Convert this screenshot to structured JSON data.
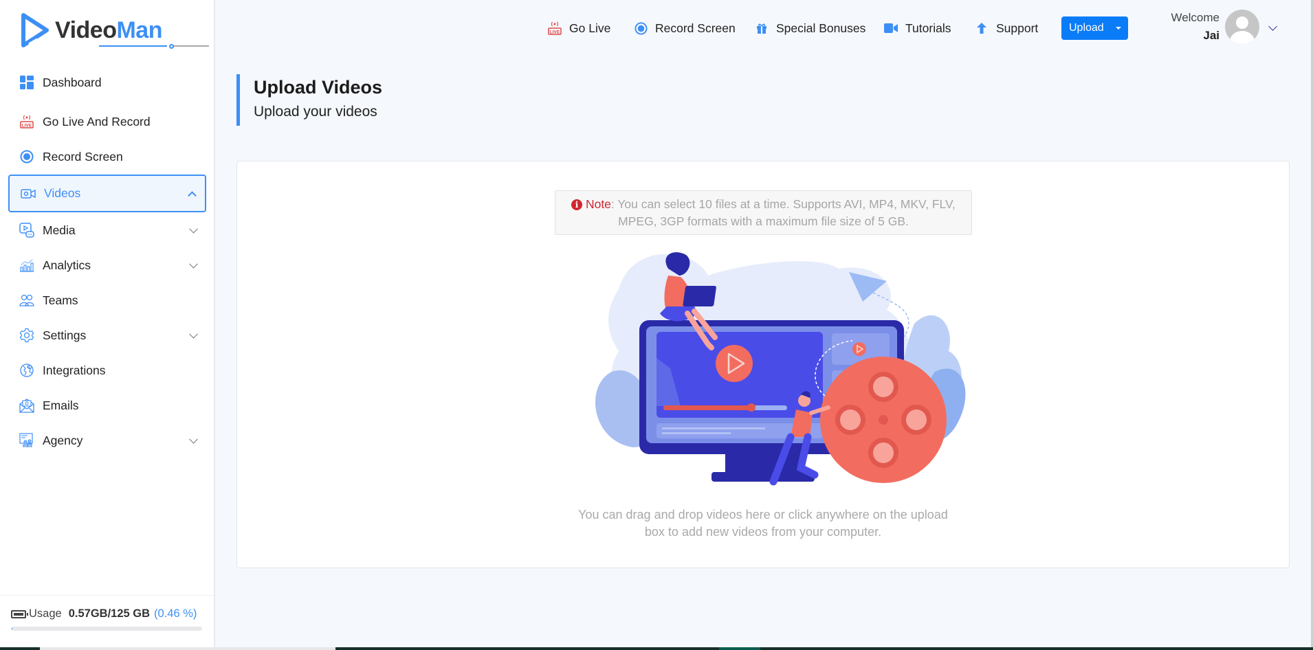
{
  "app": {
    "brand_part1": "Video",
    "brand_part2": "Man"
  },
  "sidebar": {
    "items": [
      {
        "label": "Dashboard",
        "icon": "dashboard-icon",
        "expandable": false
      },
      {
        "label": "Go Live And Record",
        "icon": "live-icon",
        "expandable": false
      },
      {
        "label": "Record Screen",
        "icon": "record-icon",
        "expandable": false
      },
      {
        "label": "Videos",
        "icon": "video-camera-icon",
        "expandable": true,
        "active": true
      },
      {
        "label": "Media",
        "icon": "media-icon",
        "expandable": true
      },
      {
        "label": "Analytics",
        "icon": "analytics-icon",
        "expandable": true
      },
      {
        "label": "Teams",
        "icon": "teams-icon",
        "expandable": false
      },
      {
        "label": "Settings",
        "icon": "gear-icon",
        "expandable": true
      },
      {
        "label": "Integrations",
        "icon": "integrations-icon",
        "expandable": false
      },
      {
        "label": "Emails",
        "icon": "email-icon",
        "expandable": false
      },
      {
        "label": "Agency",
        "icon": "agency-icon",
        "expandable": true
      }
    ],
    "usage": {
      "label": "Usage",
      "value": "0.57GB/125 GB",
      "percent_text": "(0.46 %)",
      "percent": 0.46
    }
  },
  "topnav": {
    "items": [
      {
        "label": "Go Live",
        "icon": "live-icon"
      },
      {
        "label": "Record Screen",
        "icon": "record-icon"
      },
      {
        "label": "Special Bonuses",
        "icon": "gift-icon"
      },
      {
        "label": "Tutorials",
        "icon": "video-camera-icon"
      },
      {
        "label": "Support",
        "icon": "arrow-up-icon"
      }
    ],
    "upload_label": "Upload",
    "welcome_label": "Welcome",
    "user_name": "Jai"
  },
  "page": {
    "title": "Upload Videos",
    "subtitle": "Upload your videos",
    "note_label": "Note",
    "note_text": ": You can select 10 files at a time. Supports AVI, MP4, MKV, FLV, MPEG, 3GP formats with a maximum file size of 5 GB.",
    "drop_text_1": "You can drag and drop videos here or click anywhere on the upload",
    "drop_text_2": "box to add new videos from your computer."
  },
  "colors": {
    "accent": "#3d8ff5",
    "primary_button": "#0a7cf8",
    "note_red": "#d0262f",
    "live_red": "#e04848",
    "coral": "#f26d5f",
    "indigo": "#2a2aa8"
  }
}
